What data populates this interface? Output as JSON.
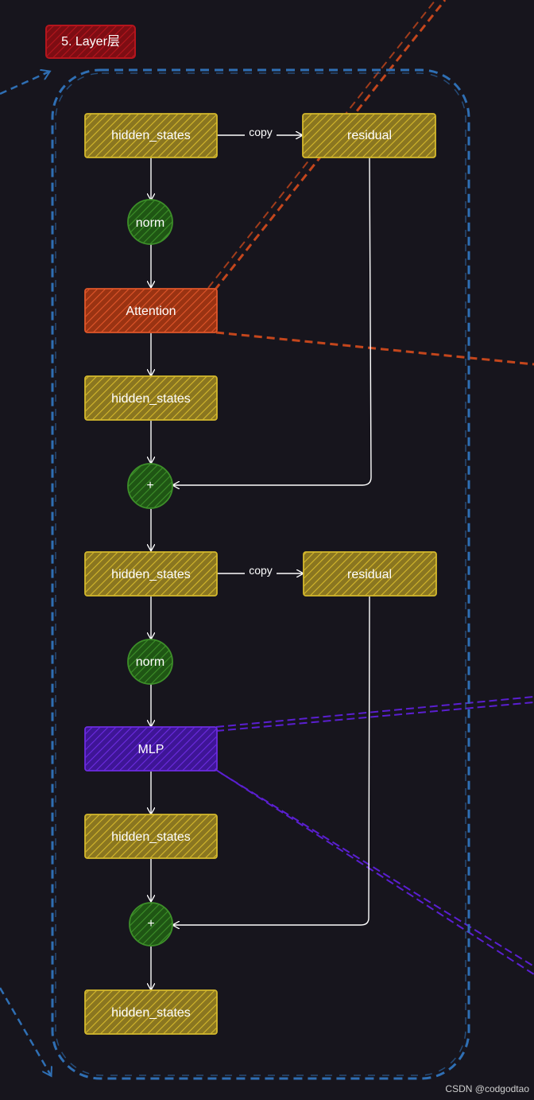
{
  "title": "5. Layer层",
  "watermark": "CSDN @codgodtao",
  "colors": {
    "background": "#17151d",
    "yellow_fill": "#b59a26",
    "yellow_stroke": "#d4b82c",
    "orange_fill": "#c4461c",
    "orange_stroke": "#e0562a",
    "purple_fill": "#5a1fd0",
    "purple_stroke": "#6c2be0",
    "green_fill": "#2f7a1f",
    "green_stroke": "#3d8f29",
    "blue_dash": "#2f6fb4",
    "red_title": "#b5151d",
    "edge": "#ffffff"
  },
  "nodes": {
    "hs1": "hidden_states",
    "residual1": "residual",
    "norm1": "norm",
    "attention": "Attention",
    "hs2": "hidden_states",
    "plus1": "+",
    "hs3": "hidden_states",
    "residual2": "residual",
    "norm2": "norm",
    "mlp": "MLP",
    "hs4": "hidden_states",
    "plus2": "+",
    "hs5": "hidden_states"
  },
  "edges": {
    "copy1": "copy",
    "copy2": "copy"
  }
}
